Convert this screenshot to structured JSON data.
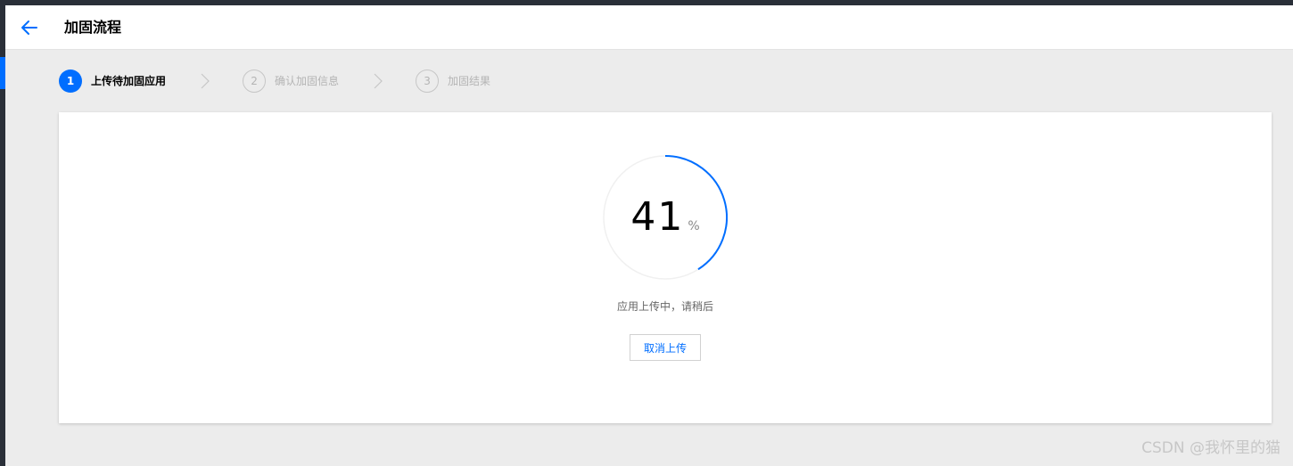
{
  "header": {
    "back_icon": "arrow-left-icon",
    "title": "加固流程"
  },
  "steps": [
    {
      "number": "1",
      "label": "上传待加固应用",
      "state": "active"
    },
    {
      "number": "2",
      "label": "确认加固信息",
      "state": "pending"
    },
    {
      "number": "3",
      "label": "加固结果",
      "state": "pending"
    }
  ],
  "progress": {
    "value": "41",
    "unit": "%",
    "fraction": 0.41
  },
  "status_text": "应用上传中，请稍后",
  "cancel_label": "取消上传",
  "watermark": "CSDN @我怀里的猫",
  "colors": {
    "accent": "#006eff",
    "track": "#f0f0f0"
  }
}
